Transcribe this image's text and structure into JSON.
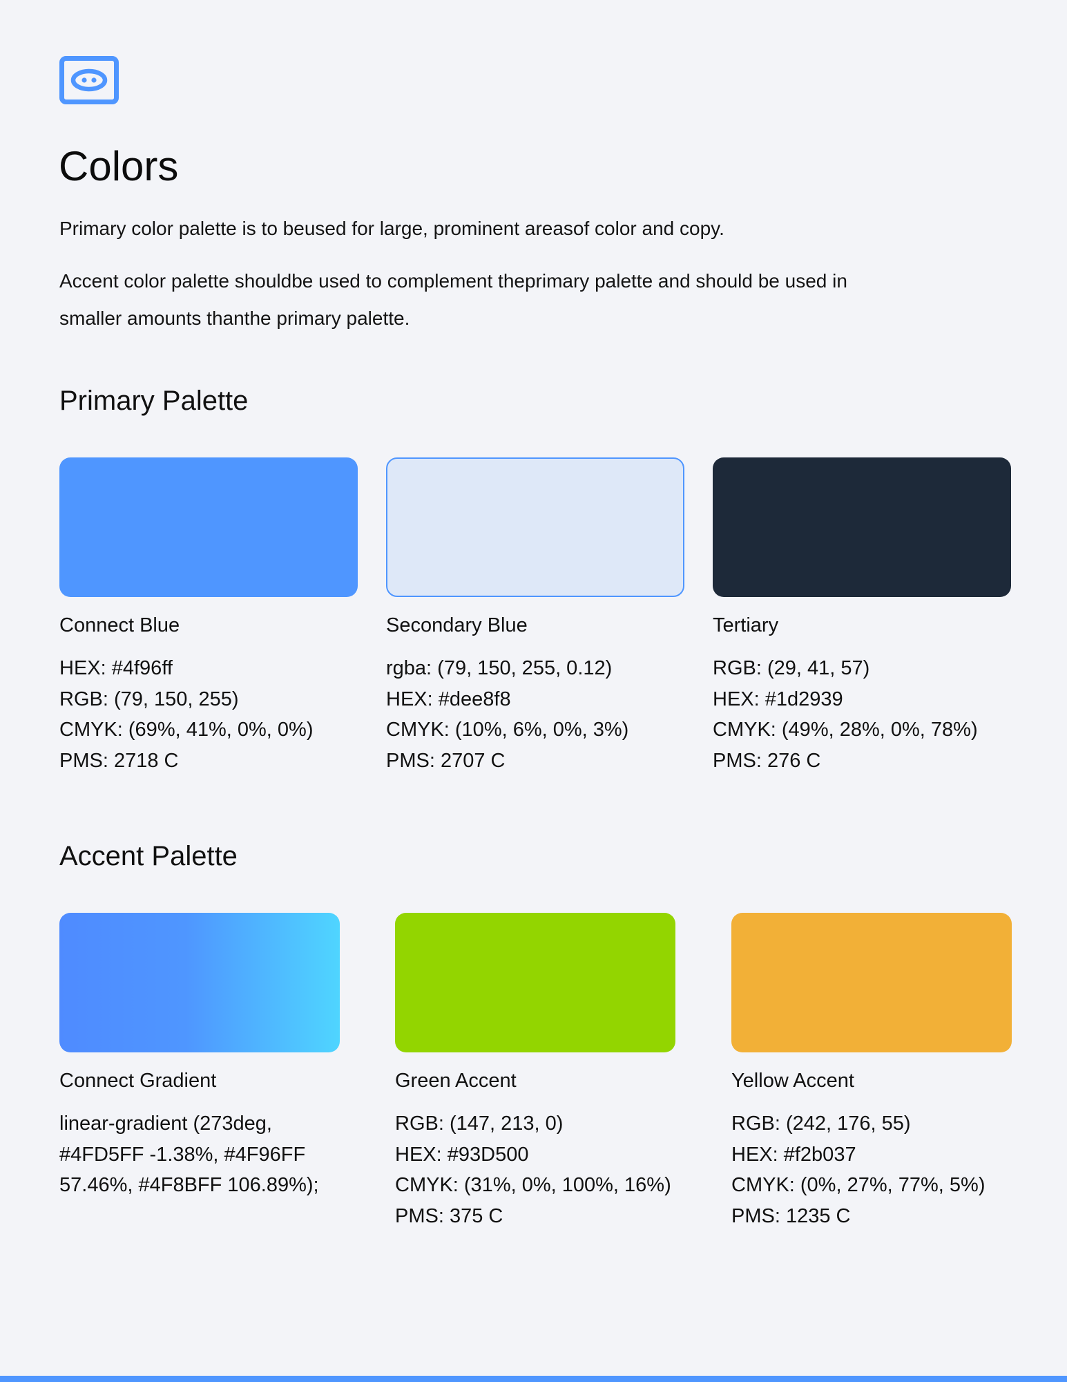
{
  "header": {
    "logo_icon": "robot-face-icon",
    "logo_color": "#4f96ff",
    "title": "Colors",
    "intro_primary": "Primary color palette is to beused for large, prominent areasof color and copy.",
    "intro_accent": "Accent color palette shouldbe used to complement theprimary palette and should be used in smaller amounts thanthe primary palette."
  },
  "primary": {
    "title": "Primary Palette",
    "swatches": [
      {
        "name": "Connect Blue",
        "fill": "#4f96ff",
        "specs": [
          "HEX: #4f96ff",
          "RGB: (79, 150, 255)",
          "CMYK: (69%, 41%, 0%, 0%)",
          "PMS: 2718 C"
        ]
      },
      {
        "name": "Secondary Blue",
        "fill": "#dee8f8",
        "border": "#4f96ff",
        "specs": [
          "rgba: (79, 150, 255, 0.12)",
          "HEX: #dee8f8",
          "CMYK: (10%, 6%, 0%, 3%)",
          "PMS: 2707 C"
        ]
      },
      {
        "name": "Tertiary",
        "fill": "#1d2939",
        "specs": [
          "RGB: (29, 41, 57)",
          "HEX: #1d2939",
          "CMYK: (49%, 28%, 0%, 78%)",
          "PMS: 276 C"
        ]
      }
    ]
  },
  "accent": {
    "title": "Accent Palette",
    "swatches": [
      {
        "name": "Connect Gradient",
        "gradient_stops": [
          "#4f8bff",
          "#4f96ff",
          "#4fd5ff"
        ],
        "spec": "linear-gradient (273deg, #4FD5FF -1.38%, #4F96FF 57.46%, #4F8BFF 106.89%);"
      },
      {
        "name": "Green Accent",
        "fill": "#93d500",
        "specs": [
          "RGB: (147, 213, 0)",
          "HEX: #93D500",
          "CMYK: (31%, 0%, 100%, 16%)",
          "PMS: 375 C"
        ]
      },
      {
        "name": "Yellow Accent",
        "fill": "#f2b037",
        "specs": [
          "RGB: (242, 176, 55)",
          "HEX: #f2b037",
          "CMYK: (0%, 27%, 77%, 5%)",
          "PMS: 1235 C"
        ]
      }
    ]
  },
  "footer": {
    "bar_color": "#4f96ff"
  }
}
